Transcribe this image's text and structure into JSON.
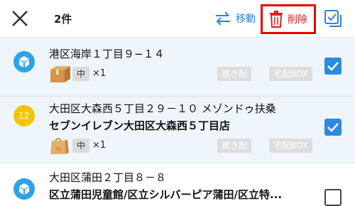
{
  "header": {
    "count": "2件",
    "move_label": "移動",
    "delete_label": "削除",
    "accent_color": "#2d82d8",
    "delete_color": "#e02020"
  },
  "rows": [
    {
      "address": "港区海岸１丁目９−１４",
      "store": "",
      "size": "中",
      "qty": "×1",
      "tags": [
        "置き配",
        "宅配BOX"
      ],
      "selected": true,
      "icon": "package-box-icon"
    },
    {
      "badge": "12",
      "address": "大田区大森西５丁目２９－１０ メゾンドゥ扶桑",
      "store": "セブンイレブン大田区大森西５丁目店",
      "size": "中",
      "qty": "×1",
      "tags": [
        "置き配",
        "宅配BOX"
      ],
      "selected": true,
      "icon": "number-badge-icon"
    },
    {
      "address": "大田区蒲田２丁目８－８",
      "store": "区立蒲田児童館/区立シルバーピア蒲田/区立特...",
      "selected": false,
      "icon": "package-box-icon"
    }
  ]
}
